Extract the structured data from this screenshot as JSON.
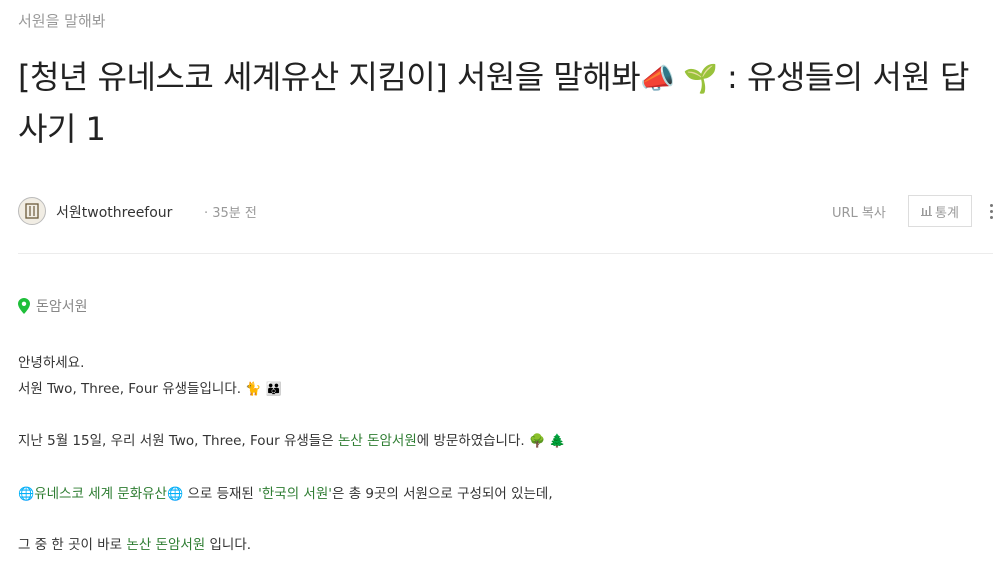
{
  "header": {
    "category": "서원을 말해봐",
    "title_part1": "[청년 유네스코 세계유산 지킴이] 서원을 말해봐",
    "title_emoji": "📣 🌱",
    "title_part2": " : 유생들의 서원 답사기 1"
  },
  "author": {
    "name": "서원twothreefour",
    "time": "· 35분 전",
    "url_copy": "URL 복사",
    "stats": "통계"
  },
  "location": {
    "name": "돈암서원"
  },
  "body": {
    "greeting": "안녕하세요.",
    "intro": "서원 Two, Three, Four 유생들입니다.",
    "intro_emoji": "🐈 👪",
    "visit_pre": "지난 5월 15일, 우리 서원 Two, Three, Four 유생들은 ",
    "visit_link": "논산 돈암서원",
    "visit_post": "에 방문하였습니다.",
    "visit_emoji": "🌳 🌲",
    "heritage_emoji": "🌐",
    "heritage_link": "유네스코 세계 문화유산",
    "heritage_mid": " 으로 등재된 ",
    "heritage_quote": "'한국의 서원'",
    "heritage_post": "은 총 9곳의 서원으로 구성되어 있는데,",
    "last_pre": "그 중 한 곳이 바로 ",
    "last_link": "논산 돈암서원",
    "last_post": " 입니다."
  }
}
